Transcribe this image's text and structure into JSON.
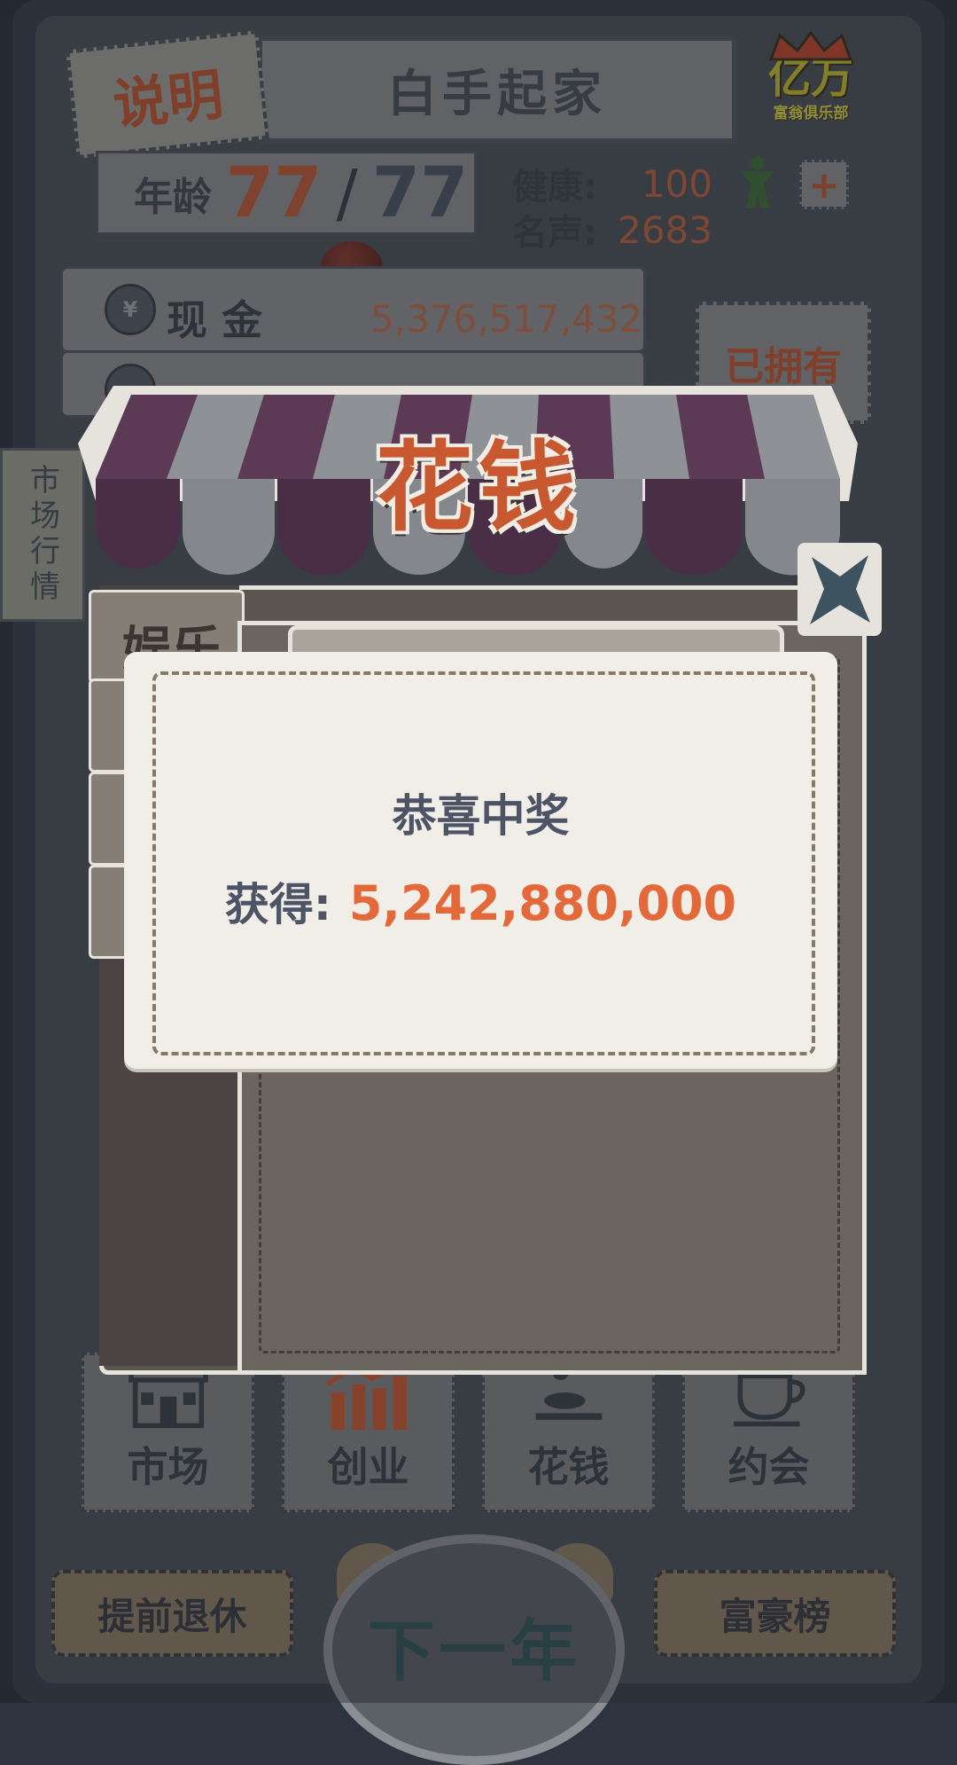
{
  "header": {
    "help_label": "说明",
    "title": "白手起家",
    "club_logo_big": "亿万",
    "club_logo_small": "富翁俱乐部"
  },
  "stats": {
    "age_label": "年龄",
    "age_current": "77",
    "age_separator": "/",
    "age_max": "77",
    "health_label": "健康:",
    "health_value": "100",
    "fame_label": "名声:",
    "fame_value": "2683"
  },
  "finance": {
    "cash_label": "现  金",
    "cash_value": "5,376,517,432",
    "coin_symbol": "¥"
  },
  "owned_label": "已拥有",
  "market_tag": "市场行情",
  "shop": {
    "title": "花钱",
    "tab_entertainment": "娱乐"
  },
  "popup": {
    "title": "恭喜中奖",
    "gain_label": "获得:",
    "gain_value": "5,242,880,000"
  },
  "nav": [
    {
      "label": "市场",
      "icon": "shop-icon",
      "active": false
    },
    {
      "label": "创业",
      "icon": "chart-icon",
      "active": true
    },
    {
      "label": "花钱",
      "icon": "spend-icon",
      "active": false
    },
    {
      "label": "约会",
      "icon": "coffee-icon",
      "active": false
    }
  ],
  "footer": {
    "retire_label": "提前退休",
    "next_year_label": "下一年",
    "rich_list_label": "富豪榜"
  },
  "colors": {
    "accent_orange": "#e3683a",
    "awning_purple": "#5c3a55",
    "health_icon_green": "#3f6e3a"
  }
}
